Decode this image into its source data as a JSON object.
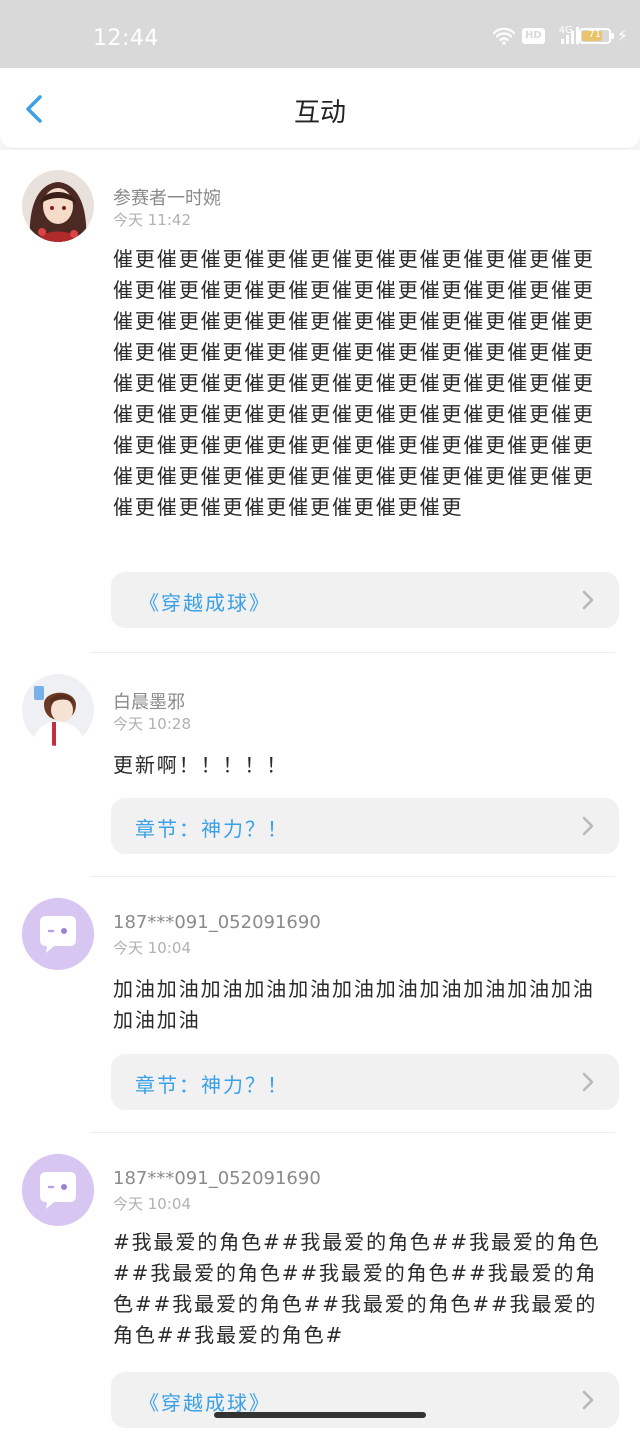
{
  "status_bar": {
    "time": "12:44",
    "network": "4G",
    "hd": "HD",
    "battery": "71"
  },
  "header": {
    "title": "互动"
  },
  "comments": [
    {
      "user": "参赛者一时婉",
      "time": "今天 11:42",
      "text": "催更催更催更催更催更催更催更催更催更催更催更催更催更催更催更催更催更催更催更催更催更催更催更催更催更催更催更催更催更催更催更催更催更催更催更催更催更催更催更催更催更催更催更催更催更催更催更催更催更催更催更催更催更催更催更催更催更催更催更催更催更催更催更催更催更催更催更催更催更催更催更催更催更催更催更催更催更催更催更催更催更催更催更催更催更催更催更催更催更催更催更催更催更催更催更催更",
      "link": "《穿越成球》"
    },
    {
      "user": "白晨墨邪",
      "time": "今天 10:28",
      "text": "更新啊！！！！！",
      "link": "章节：神力？！"
    },
    {
      "user": "187***091_052091690",
      "time": "今天 10:04",
      "text": "加油加油加油加油加油加油加油加油加油加油加油加油加油",
      "link": "章节：神力？！"
    },
    {
      "user": "187***091_052091690",
      "time": "今天 10:04",
      "text": "#我最爱的角色##我最爱的角色##我最爱的角色##我最爱的角色##我最爱的角色##我最爱的角色##我最爱的角色##我最爱的角色##我最爱的角色##我最爱的角色#",
      "link": "《穿越成球》"
    }
  ],
  "colors": {
    "accent": "#3aa0e8",
    "status_bar": "#d9d9d9",
    "bot_avatar": "#d8c6f2"
  }
}
